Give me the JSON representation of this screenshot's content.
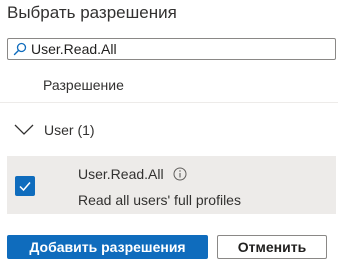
{
  "panel": {
    "title": "Выбрать разрешения"
  },
  "search": {
    "value": "User.Read.All",
    "icon": "search-icon"
  },
  "table": {
    "column_header": "Разрешение",
    "group": {
      "label": "User (1)",
      "expanded": true,
      "icon": "chevron-down-icon"
    },
    "rows": [
      {
        "name": "User.Read.All",
        "description": "Read all users' full profiles",
        "checked": true,
        "info_icon": "info-icon"
      }
    ]
  },
  "footer": {
    "add_label": "Добавить разрешения",
    "cancel_label": "Отменить"
  },
  "colors": {
    "accent": "#0f6cbd",
    "row_selected_bg": "#edebe9",
    "text": "#323130"
  }
}
